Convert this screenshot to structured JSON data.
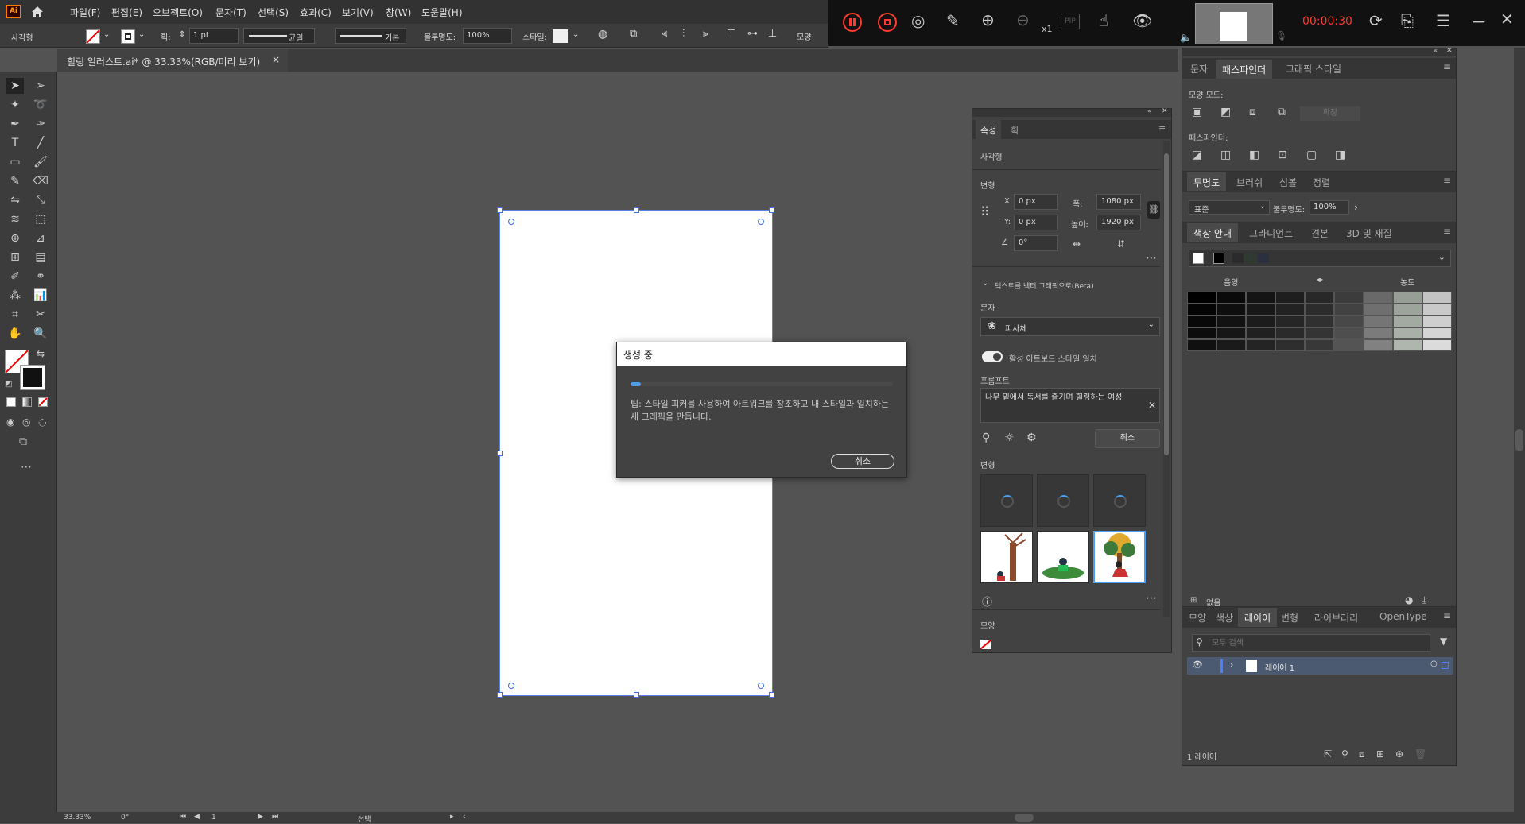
{
  "app": {
    "logo": "Ai"
  },
  "menu": [
    "파일(F)",
    "편집(E)",
    "오브젝트(O)",
    "문자(T)",
    "선택(S)",
    "효과(C)",
    "보기(V)",
    "창(W)",
    "도움말(H)"
  ],
  "recorder": {
    "timer": "00:00:30",
    "zoom_label": "x1",
    "pip_label": "PIP"
  },
  "control_bar": {
    "object_type": "사각형",
    "stroke_label": "획:",
    "stroke_weight": "1 pt",
    "stroke_profile": "균일",
    "brush": "기본",
    "opacity_label": "불투명도:",
    "opacity": "100%",
    "style_label": "스타일:",
    "shape_label": "모양"
  },
  "document_tab": {
    "title": "힐링 일러스트.ai* @ 33.33%(RGB/미리 보기)",
    "close": "×"
  },
  "dialog": {
    "title": "생성 중",
    "progress": 0.04,
    "tip": "팁: 스타일 피커를 사용하여 아트워크를 참조하고 내 스타일과 일치하는 새 그래픽을 만듭니다.",
    "cancel": "취소"
  },
  "properties": {
    "tabs": [
      "속성",
      "획"
    ],
    "object_type": "사각형",
    "transform_label": "변형",
    "x_label": "X:",
    "x": "0 px",
    "y_label": "Y:",
    "y": "0 px",
    "w_label": "폭:",
    "w": "1080 px",
    "h_label": "높이:",
    "h": "1920 px",
    "angle": "0°",
    "text_to_vector_label": "텍스트를 벡터 그래픽으로(Beta)",
    "type_label": "문자",
    "type_value": "피사체",
    "match_style_label": "활성 아트보드 스타일 일치",
    "prompt_label": "프롬프트",
    "prompt": "나무 밑에서 독서를 즐기며 힐링하는 여성",
    "cancel": "취소",
    "variations_label": "변형",
    "appearance_label": "모양"
  },
  "right_panel": {
    "top_tabs": [
      "문자",
      "패스파인더",
      "그래픽 스타일"
    ],
    "shape_modes_label": "모양 모드:",
    "expand_label": "확장",
    "pathfinders_label": "패스파인더:",
    "transparency_tabs": [
      "투명도",
      "브러쉬",
      "심볼",
      "정렬"
    ],
    "blend_mode": "표준",
    "opacity_label": "불투명도:",
    "opacity": "100%",
    "color_guide_tabs": [
      "색상 안내",
      "그라디언트",
      "견본",
      "3D 및 재질"
    ],
    "shade_label": "음영",
    "tint_label": "농도",
    "none_label": "없음",
    "layers_tabs": [
      "모양",
      "색상",
      "레이어",
      "변형",
      "라이브러리",
      "OpenType"
    ],
    "search_placeholder": "모두 검색",
    "layer_name": "레이어 1",
    "layer_count": "1 레이어"
  },
  "status_bar": {
    "zoom": "33.33%",
    "rotation": "0°",
    "artboard": "1",
    "tool": "선택"
  },
  "colors": {
    "accent": "#4a9ff5",
    "artboard_border": "#3a6cf0",
    "timer": "#ff3b30"
  }
}
